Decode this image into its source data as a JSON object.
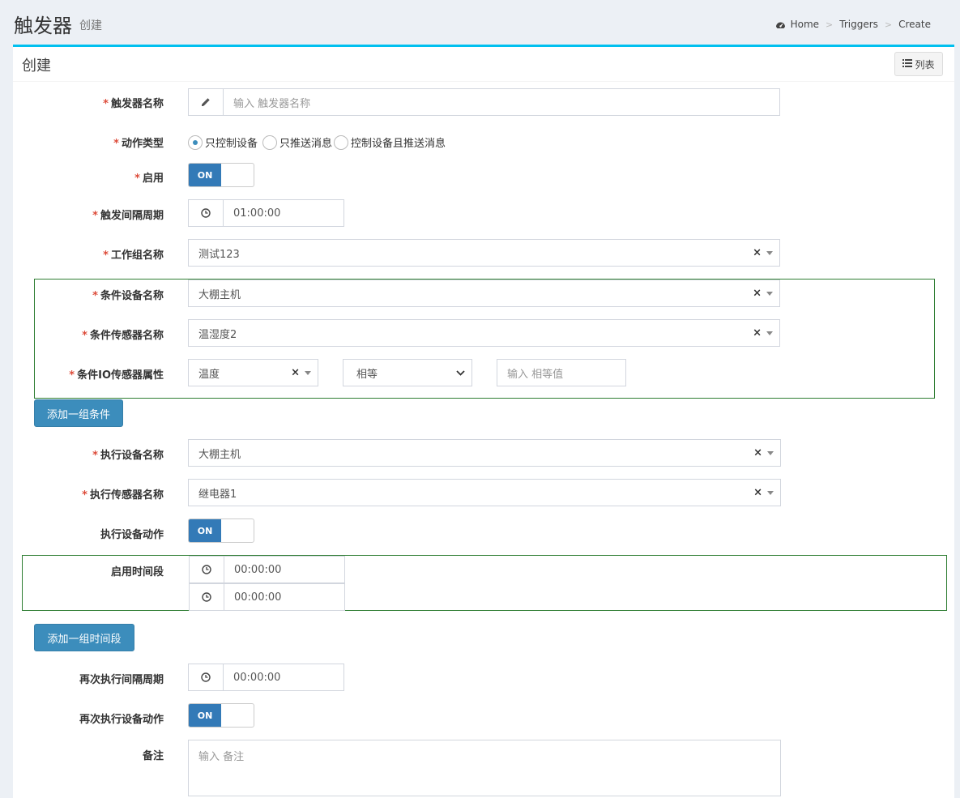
{
  "header": {
    "title": "触发器",
    "subtitle": "创建",
    "breadcrumb": [
      "Home",
      "Triggers",
      "Create"
    ]
  },
  "box": {
    "title": "创建",
    "list_button": "列表"
  },
  "form": {
    "trigger_name": {
      "label": "触发器名称",
      "placeholder": "输入 触发器名称"
    },
    "action_type": {
      "label": "动作类型",
      "options": [
        "只控制设备",
        "只推送消息",
        "控制设备且推送消息"
      ],
      "selected": "只控制设备"
    },
    "enabled": {
      "label": "启用",
      "state": "ON"
    },
    "interval": {
      "label": "触发间隔周期",
      "value": "01:00:00"
    },
    "workgroup": {
      "label": "工作组名称",
      "value": "测试123"
    },
    "condition": {
      "device": {
        "label": "条件设备名称",
        "value": "大棚主机"
      },
      "sensor": {
        "label": "条件传感器名称",
        "value": "温湿度2"
      },
      "io_attr": {
        "label": "条件IO传感器属性",
        "value": "温度",
        "operator": "相等",
        "compare_placeholder": "输入 相等值"
      }
    },
    "add_condition_button": "添加一组条件",
    "exec_device": {
      "label": "执行设备名称",
      "value": "大棚主机"
    },
    "exec_sensor": {
      "label": "执行传感器名称",
      "value": "继电器1"
    },
    "exec_action": {
      "label": "执行设备动作",
      "state": "ON"
    },
    "time_range": {
      "label": "启用时间段",
      "start": "00:00:00",
      "end": "00:00:00"
    },
    "add_time_button": "添加一组时间段",
    "re_interval": {
      "label": "再次执行间隔周期",
      "value": "00:00:00"
    },
    "re_action": {
      "label": "再次执行设备动作",
      "state": "ON"
    },
    "remark": {
      "label": "备注",
      "placeholder": "输入 备注"
    }
  },
  "colors": {
    "accent": "#00c0ef",
    "primary": "#3c8dbc",
    "required": "#dd4b39",
    "group_border": "#2e7d32",
    "background": "#ecf0f5"
  }
}
